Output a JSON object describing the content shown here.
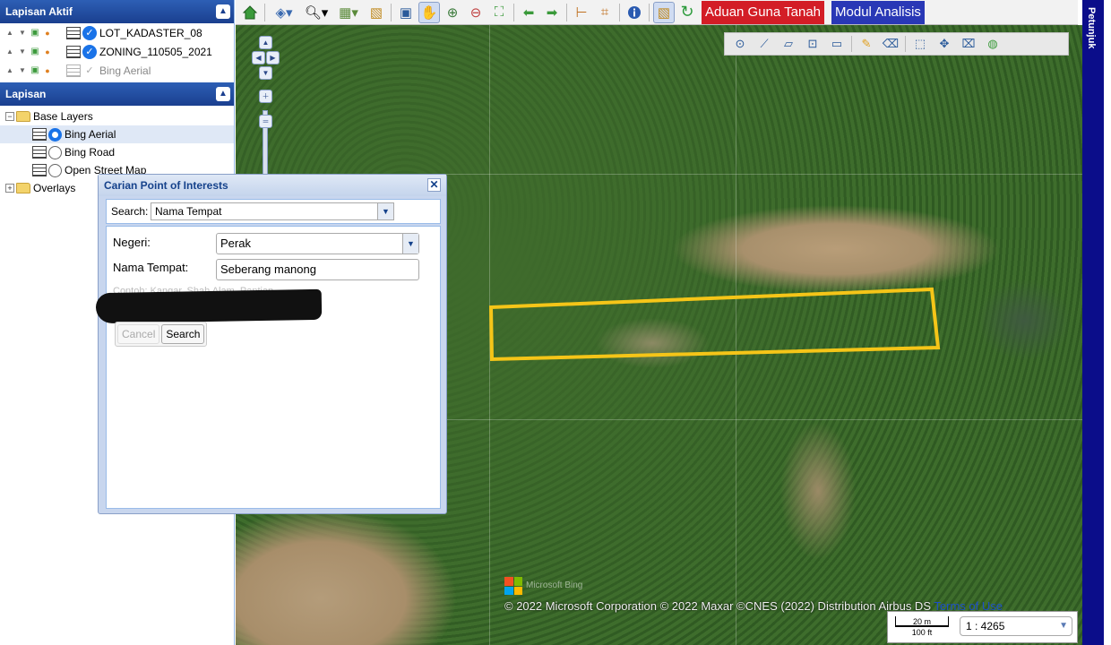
{
  "active_layers": {
    "title": "Lapisan Aktif",
    "items": [
      {
        "label": "LOT_KADASTER_08",
        "checked": true
      },
      {
        "label": "ZONING_110505_2021",
        "checked": true
      },
      {
        "label": "Bing Aerial",
        "checked": false
      }
    ]
  },
  "layers": {
    "title": "Lapisan",
    "tree": {
      "base_layers": "Base Layers",
      "bing_aerial": "Bing Aerial",
      "bing_road": "Bing Road",
      "open_street_map": "Open Street Map",
      "overlays": "Overlays"
    }
  },
  "toolbar": {
    "aduan_button": "Aduan Guna Tanah",
    "modul_button": "Modul Analisis"
  },
  "side_panel": {
    "label": "Petunjuk"
  },
  "dialog": {
    "title": "Carian Point of Interests",
    "search_label": "Search:",
    "search_type": "Nama Tempat",
    "negeri_label": "Negeri:",
    "negeri_value": "Perak",
    "nama_label": "Nama Tempat:",
    "nama_value": "Seberang manong",
    "hint": "Contoh: Kangar, Shah Alam, Pantian",
    "cancel_button": "Cancel",
    "search_button": "Search"
  },
  "map": {
    "copyright": "© 2022 Microsoft Corporation © 2022 Maxar ©CNES (2022) Distribution Airbus DS",
    "terms_link": "Terms of Use",
    "ms_logo_text": "Microsoft Bing",
    "scale_metric": "20 m",
    "scale_imperial": "100 ft",
    "scale_ratio": "1 : 4265",
    "highlight_color": "#f5c518"
  },
  "colors": {
    "panel_header": "#1a3f8f",
    "aduan_bg": "#d31d26",
    "modul_bg": "#2938b6",
    "right_strip": "#0b0d8a"
  }
}
